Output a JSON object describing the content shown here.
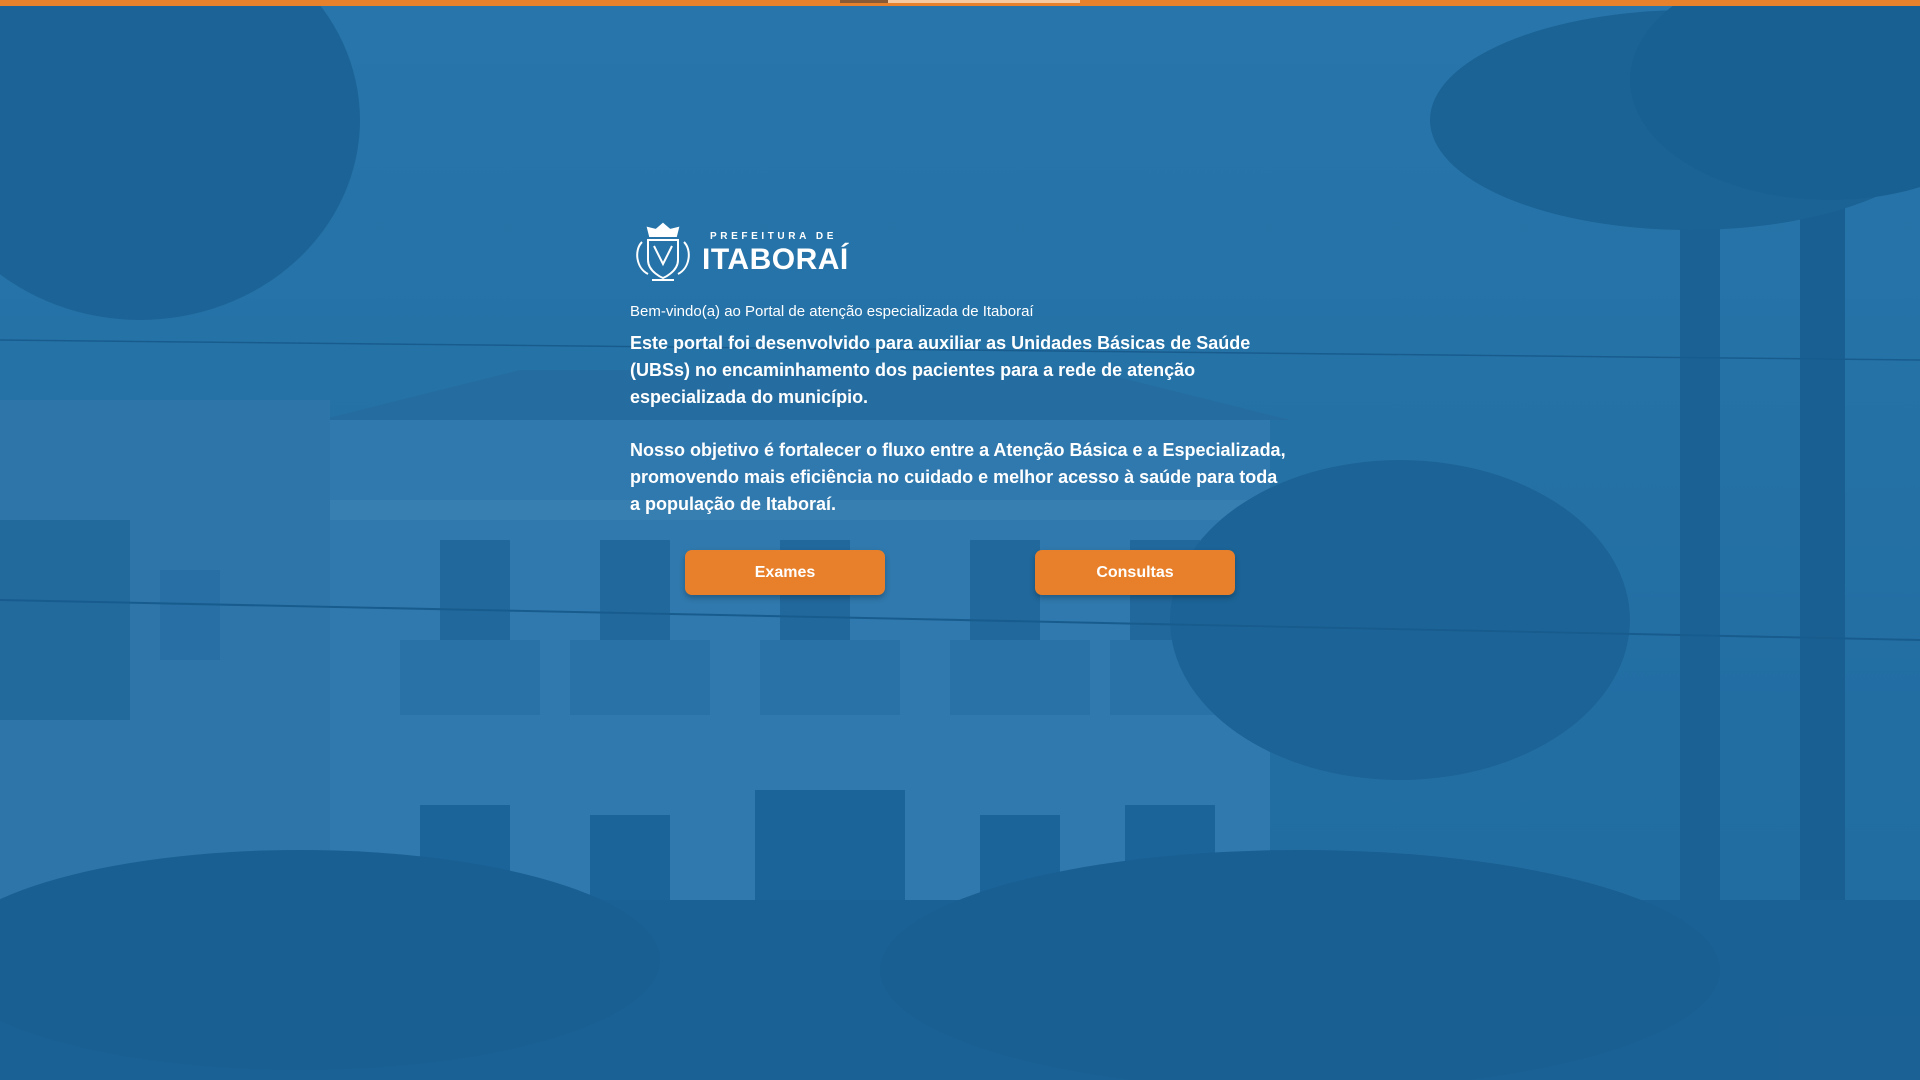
{
  "brand": {
    "prefix": "PREFEITURA DE",
    "name": "ITABORAÍ",
    "accent_color": "#e8802b",
    "overlay_color": "#1868a0"
  },
  "intro": {
    "welcome": "Bem-vindo(a) ao Portal de atenção especializada de Itaboraí",
    "paragraph1": {
      "part1": "Este portal foi desenvolvido para ",
      "bold": "auxiliar as Unidades Básicas de Saúde (UBSs)",
      "part2": " no encaminhamento dos pacientes para a rede de atenção especializada do município."
    },
    "paragraph2": {
      "part1": "Nosso objetivo é ",
      "bold": "fortalecer o fluxo entre a Atenção Básica e a Especializada",
      "part2": ", promovendo mais eficiência no cuidado e melhor acesso à saúde para toda a população de Itaboraí."
    }
  },
  "actions": {
    "exames_label": "Exames",
    "consultas_label": "Consultas"
  },
  "icons": {
    "logo": "municipal-coat-of-arms-icon"
  }
}
